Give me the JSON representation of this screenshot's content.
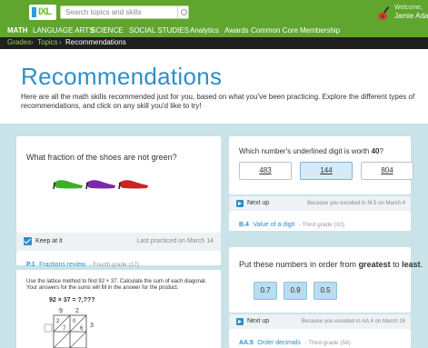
{
  "header": {
    "logo_text": "IXL",
    "search_placeholder": "Search topics and skills",
    "welcome_label": "Welcome,",
    "user_name": "Jamie Adams ▾"
  },
  "nav": {
    "items": [
      "MATH",
      "LANGUAGE ARTS",
      "SCIENCE",
      "SOCIAL STUDIES",
      "Analytics",
      "Awards",
      "Common Core",
      "Membership"
    ]
  },
  "breadcrumb": {
    "items": [
      "Grades",
      "Topics",
      "Recommendations"
    ],
    "separator": "›"
  },
  "page": {
    "title": "Recommendations",
    "description": "Here are all the math skills recommended just for you, based on what you've been practicing. Explore the different types of recommendations, and click on any skill you'd like to try!"
  },
  "card_shoes": {
    "question": "What fraction of the shoes are not green?",
    "keep_label": "Keep at it",
    "last_practiced": "Last practiced on March 14",
    "skill_code": "P.1",
    "skill_name": "Fractions review",
    "skill_grade": "- Fourth grade (17)"
  },
  "card_lattice": {
    "instructions": "Use the lattice method to find 92 × 37. Calculate the sum of each diagonal. Your answers for the sums will fill in the answer for the product.",
    "equation": "92 × 37 = ?,???",
    "digits_top": [
      "9",
      "2"
    ],
    "digits_side": [
      "3"
    ],
    "cells": [
      "2",
      "0",
      "7",
      "6"
    ]
  },
  "card_digit": {
    "question_prefix": "Which number's underlined digit is worth ",
    "question_value": "40",
    "question_suffix": "?",
    "options": [
      "483",
      "144",
      "804"
    ],
    "next_label": "Next up",
    "because": "Because you excelled in M.5 on March 4",
    "skill_code": "B.4",
    "skill_name": "Value of a digit",
    "skill_grade": "- Third grade (10)"
  },
  "card_order": {
    "question_prefix": "Put these numbers in order from ",
    "question_bold1": "greatest",
    "question_mid": " to ",
    "question_bold2": "least",
    "question_suffix": ".",
    "tiles": [
      "0.7",
      "0.9",
      "0.5"
    ],
    "next_label": "Next up",
    "because": "Because you excelled in AA.4 on March 16",
    "skill_code": "AA.5",
    "skill_name": "Order decimals",
    "skill_grade": "- Third grade (58)"
  },
  "colors": {
    "brand_green": "#5fa52e",
    "title_blue": "#2e8fc8",
    "background": "#c9e3e9"
  }
}
